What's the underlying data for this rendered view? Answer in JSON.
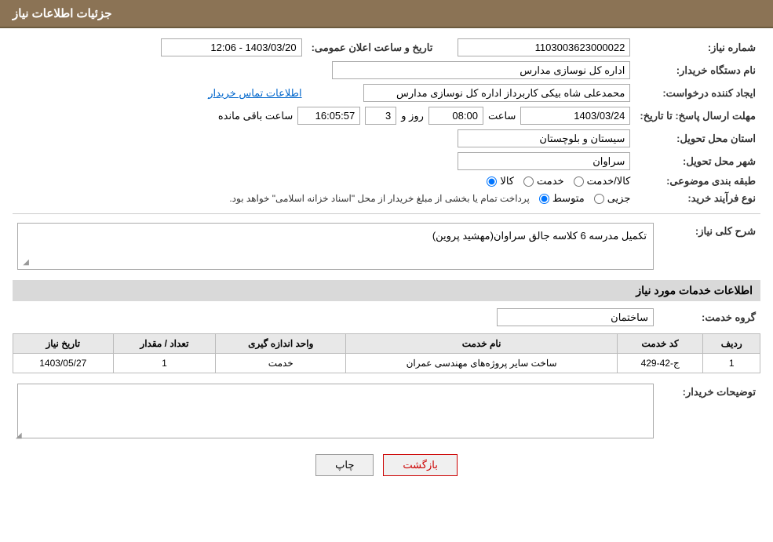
{
  "header": {
    "title": "جزئیات اطلاعات نیاز"
  },
  "fields": {
    "need_number_label": "شماره نیاز:",
    "need_number_value": "1103003623000022",
    "announce_date_label": "تاریخ و ساعت اعلان عمومی:",
    "announce_date_value": "1403/03/20 - 12:06",
    "org_name_label": "نام دستگاه خریدار:",
    "org_name_value": "اداره کل نوسازی مدارس",
    "requester_label": "ایجاد کننده درخواست:",
    "requester_value": "محمدعلی شاه بیکی کاربرداز اداره کل نوسازی مدارس",
    "contact_link": "اطلاعات تماس خریدار",
    "reply_deadline_label": "مهلت ارسال پاسخ: تا تاریخ:",
    "reply_date_value": "1403/03/24",
    "reply_time_label": "ساعت",
    "reply_time_value": "08:00",
    "reply_days_label": "روز و",
    "reply_days_value": "3",
    "reply_hours_label": "ساعت باقی مانده",
    "reply_remaining_value": "16:05:57",
    "province_label": "استان محل تحویل:",
    "province_value": "سیستان و بلوچستان",
    "city_label": "شهر محل تحویل:",
    "city_value": "سراوان",
    "category_label": "طبقه بندی موضوعی:",
    "category_kala": "کالا",
    "category_khedmat": "خدمت",
    "category_kala_khedmat": "کالا/خدمت",
    "purchase_type_label": "نوع فرآیند خرید:",
    "purchase_jozii": "جزیی",
    "purchase_mottaset": "متوسط",
    "purchase_note": "پرداخت تمام یا بخشی از مبلغ خریدار از محل \"اسناد خزانه اسلامی\" خواهد بود.",
    "description_label": "شرح کلی نیاز:",
    "description_value": "تکمیل مدرسه 6 کلاسه جالق سراوان(مهشید پروین)",
    "services_section_label": "اطلاعات خدمات مورد نیاز",
    "service_group_label": "گروه خدمت:",
    "service_group_value": "ساختمان",
    "table_headers": {
      "row_num": "ردیف",
      "service_code": "کد خدمت",
      "service_name": "نام خدمت",
      "unit": "واحد اندازه گیری",
      "quantity": "تعداد / مقدار",
      "date": "تاریخ نیاز"
    },
    "table_rows": [
      {
        "row_num": "1",
        "service_code": "ج-42-429",
        "service_name": "ساخت سایر پروژه‌های مهندسی عمران",
        "unit": "خدمت",
        "quantity": "1",
        "date": "1403/05/27"
      }
    ],
    "buyer_notes_label": "توضیحات خریدار:",
    "btn_print": "چاپ",
    "btn_back": "بازگشت"
  }
}
